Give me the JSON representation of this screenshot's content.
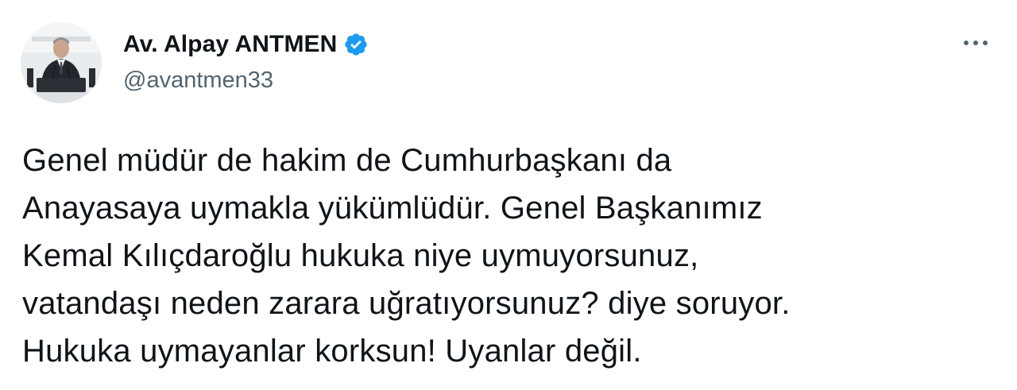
{
  "tweet": {
    "author": {
      "display_name": "Av. Alpay ANTMEN",
      "handle": "@avantmen33",
      "verified": true,
      "avatar_icon": "profile-photo-speaker-at-podium"
    },
    "more_icon": "more-options-icon",
    "text_lines": [
      "Genel müdür de hakim de Cumhurbaşkanı da",
      "Anayasaya uymakla yükümlüdür. Genel Başkanımız",
      "Kemal Kılıçdaroğlu hukuka niye uymuyorsunuz,",
      "vatandaşı neden zarara uğratıyorsunuz? diye soruyor.",
      "Hukuka uymayanlar korksun! Uyanlar değil."
    ]
  },
  "colors": {
    "text": "#0f1419",
    "secondary": "#536471",
    "verified_blue": "#1d9bf0",
    "background": "#ffffff"
  }
}
